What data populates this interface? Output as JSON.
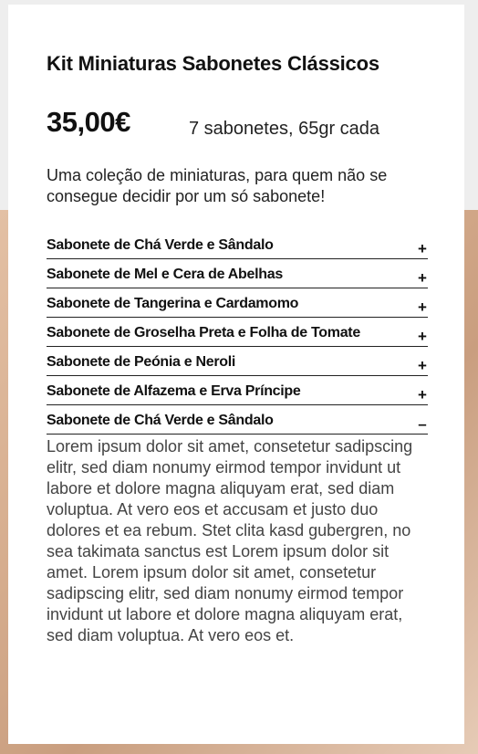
{
  "product": {
    "title": "Kit Miniaturas Sabonetes Clássicos",
    "price": "35,00€",
    "size_info": "7 sabonetes, 65gr cada",
    "description": "Uma coleção de miniaturas, para quem não se consegue decidir por um só sabonete!"
  },
  "accordion": {
    "items": [
      {
        "label": "Sabonete de Chá Verde e Sândalo",
        "toggle": "+"
      },
      {
        "label": "Sabonete de Mel e Cera de Abelhas",
        "toggle": "+"
      },
      {
        "label": "Sabonete de Tangerina e Cardamomo",
        "toggle": "+"
      },
      {
        "label": "Sabonete de Groselha Preta e Folha de Tomate",
        "toggle": "+"
      },
      {
        "label": "Sabonete de Peónia e Neroli",
        "toggle": "+"
      },
      {
        "label": "Sabonete de Alfazema e Erva Príncipe",
        "toggle": "+"
      },
      {
        "label": "Sabonete de Chá Verde e Sândalo",
        "toggle": "–"
      }
    ],
    "expanded_body": "Lorem ipsum dolor sit amet, consetetur sadipscing elitr, sed diam nonumy eirmod tempor invidunt ut labore et dolore magna aliquyam erat, sed diam voluptua. At vero eos et accusam et justo duo dolores et ea rebum. Stet clita kasd gubergren, no sea takimata sanctus est Lorem ipsum dolor sit amet. Lorem ipsum dolor sit amet, consetetur sadipscing elitr, sed diam nonumy eirmod tempor invidunt ut labore et dolore magna aliquyam erat, sed diam voluptua. At vero eos et."
  }
}
